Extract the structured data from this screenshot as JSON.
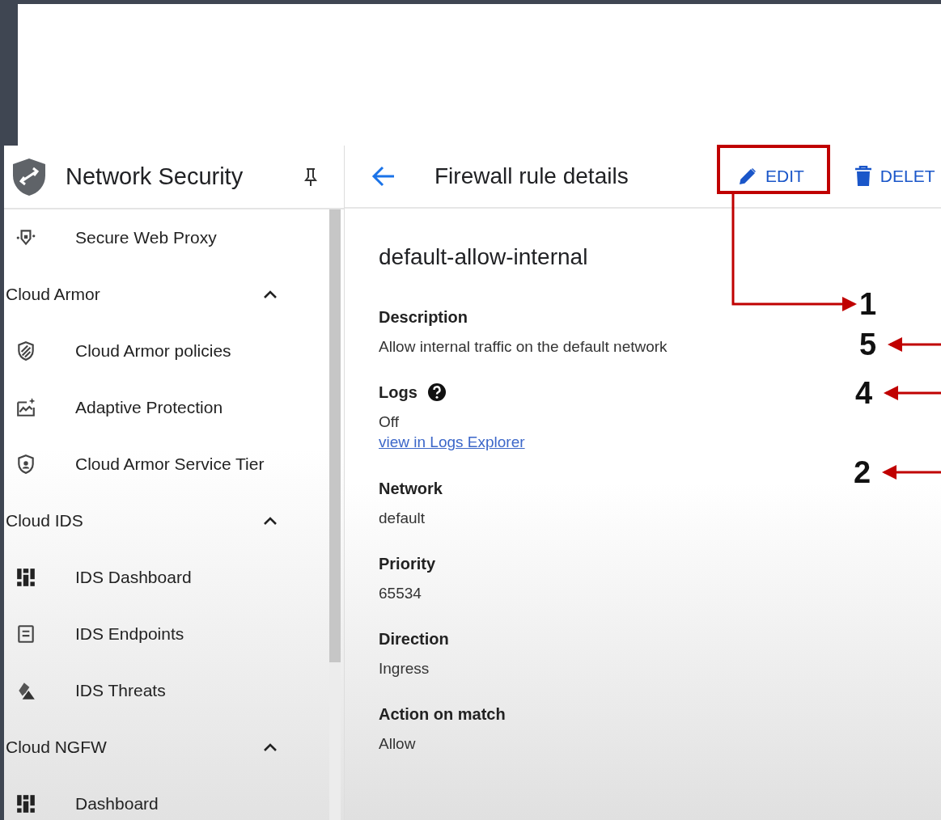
{
  "sidebar": {
    "title": "Network Security",
    "nav": [
      {
        "kind": "item",
        "label": "Secure Web Proxy"
      },
      {
        "kind": "section",
        "label": "Cloud Armor",
        "expanded": true,
        "children": [
          {
            "kind": "item",
            "label": "Cloud Armor policies"
          },
          {
            "kind": "item",
            "label": "Adaptive Protection"
          },
          {
            "kind": "item",
            "label": "Cloud Armor Service Tier"
          }
        ]
      },
      {
        "kind": "section",
        "label": "Cloud IDS",
        "expanded": true,
        "children": [
          {
            "kind": "item",
            "label": "IDS Dashboard"
          },
          {
            "kind": "item",
            "label": "IDS Endpoints"
          },
          {
            "kind": "item",
            "label": "IDS Threats"
          }
        ]
      },
      {
        "kind": "section",
        "label": "Cloud NGFW",
        "expanded": true,
        "children": [
          {
            "kind": "item",
            "label": "Dashboard"
          }
        ]
      }
    ]
  },
  "header": {
    "title": "Firewall rule details",
    "actions": [
      {
        "label": "EDIT",
        "kind": "edit"
      },
      {
        "label": "DELET",
        "kind": "delete"
      }
    ]
  },
  "rule": {
    "name": "default-allow-internal",
    "fields": [
      {
        "label": "Description",
        "value": "Allow internal traffic on the default network"
      },
      {
        "label": "Logs",
        "help": true,
        "value": "Off",
        "link": "view in Logs Explorer"
      },
      {
        "label": "Network",
        "value": "default"
      },
      {
        "label": "Priority",
        "value": "65534"
      },
      {
        "label": "Direction",
        "value": "Ingress"
      },
      {
        "label": "Action on match",
        "value": "Allow"
      }
    ]
  },
  "annotations": [
    {
      "label": "1",
      "kind": "elbow"
    },
    {
      "label": "5",
      "kind": "arrow"
    },
    {
      "label": "4",
      "kind": "arrow"
    },
    {
      "label": "2",
      "kind": "arrow"
    }
  ]
}
